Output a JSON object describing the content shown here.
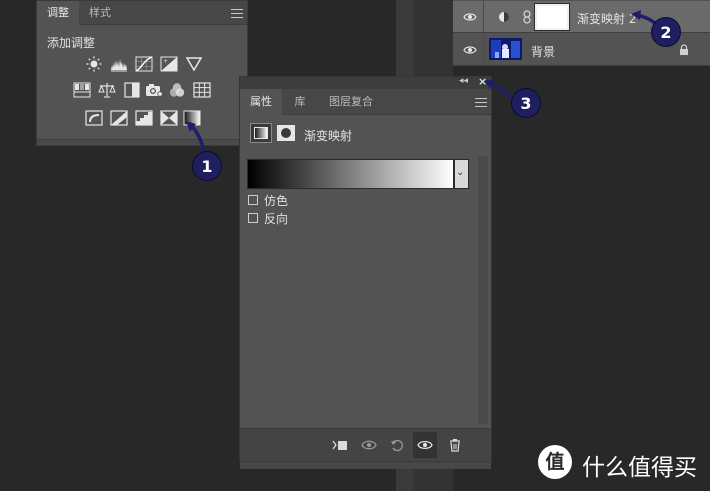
{
  "adjustments_panel": {
    "tabs": [
      "调整",
      "样式"
    ],
    "add_adjustment_label": "添加调整",
    "icons_row1": [
      "brightness-contrast-icon",
      "levels-icon",
      "curves-icon",
      "exposure-icon",
      "vibrance-icon"
    ],
    "icons_row2": [
      "hue-saturation-icon",
      "color-balance-icon",
      "black-white-icon",
      "photo-filter-icon",
      "channel-mixer-icon",
      "color-lookup-icon"
    ],
    "icons_row3": [
      "invert-icon",
      "posterize-icon",
      "threshold-icon",
      "selective-color-icon",
      "gradient-map-icon"
    ]
  },
  "layers_panel": {
    "layers": [
      {
        "name": "渐变映射 2",
        "kind": "adjustment"
      },
      {
        "name": "背景",
        "kind": "background"
      }
    ]
  },
  "properties_panel": {
    "tabs": [
      "属性",
      "库",
      "图层复合"
    ],
    "header_label": "渐变映射",
    "options": [
      {
        "label": "仿色",
        "checked": false
      },
      {
        "label": "反向",
        "checked": false
      }
    ]
  },
  "annotations": [
    "1",
    "2",
    "3"
  ],
  "watermark": {
    "text": "什么值得买",
    "logo_glyph": "值"
  },
  "colors": {
    "panel": "#535353",
    "background": "#282828",
    "callout": "#1f1e5e",
    "arrow": "#1f1e6a"
  }
}
